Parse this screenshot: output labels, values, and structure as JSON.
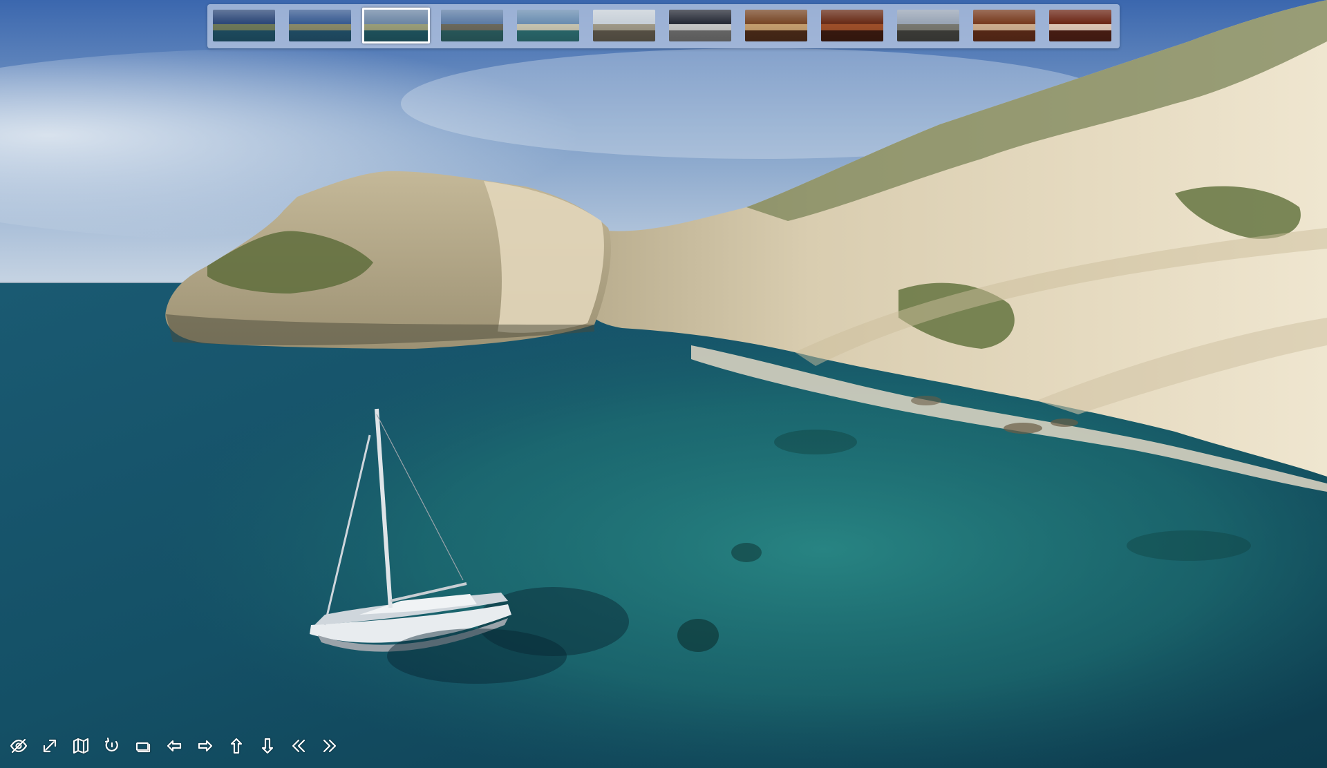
{
  "viewer": {
    "active_thumb_index": 2
  },
  "thumbnails": [
    {
      "name": "thumb-aerial-coast-1",
      "sky": "#2f4a7a",
      "mid": "#6f7a5a",
      "base": "#1e4e63"
    },
    {
      "name": "thumb-aerial-coast-2",
      "sky": "#3b5d93",
      "mid": "#8a8a6a",
      "base": "#214f68"
    },
    {
      "name": "thumb-aerial-coast-3",
      "sky": "#6f88a6",
      "mid": "#9b9f7a",
      "base": "#1f5560"
    },
    {
      "name": "thumb-harbor-aerial",
      "sky": "#5f7ea6",
      "mid": "#6c6a5c",
      "base": "#2a5b5e"
    },
    {
      "name": "thumb-beach-aerial",
      "sky": "#6d8fb2",
      "mid": "#c9c6b2",
      "base": "#2b6a6e"
    },
    {
      "name": "thumb-deck-bow",
      "sky": "#c8d0d8",
      "mid": "#a09a88",
      "base": "#5a5448"
    },
    {
      "name": "thumb-cockpit",
      "sky": "#2a2e3a",
      "mid": "#c9c9c9",
      "base": "#6a6a6a"
    },
    {
      "name": "thumb-cabin-saloon",
      "sky": "#7a4a2a",
      "mid": "#c7a070",
      "base": "#4a2a18"
    },
    {
      "name": "thumb-cabin-galley",
      "sky": "#6a2e1a",
      "mid": "#a0502a",
      "base": "#3a1a10"
    },
    {
      "name": "thumb-deck-stern",
      "sky": "#9aa6b6",
      "mid": "#7a7a72",
      "base": "#3e3e3a"
    },
    {
      "name": "thumb-cabin-forward",
      "sky": "#7a3e22",
      "mid": "#d0b090",
      "base": "#5a2a18"
    },
    {
      "name": "thumb-cabin-aft",
      "sky": "#6e2a1a",
      "mid": "#e0c8b8",
      "base": "#4a1e14"
    }
  ],
  "controls": [
    {
      "name": "hide-controls-button",
      "icon": "eye-slash-icon",
      "label": "Hide"
    },
    {
      "name": "fullscreen-button",
      "icon": "expand-arrows-icon",
      "label": "Fullscreen"
    },
    {
      "name": "map-button",
      "icon": "map-icon",
      "label": "Map"
    },
    {
      "name": "autorotate-button",
      "icon": "rotate-icon",
      "label": "Autorotate"
    },
    {
      "name": "gallery-toggle-button",
      "icon": "thumbnails-icon",
      "label": "Thumbnails"
    },
    {
      "name": "pan-left-button",
      "icon": "arrow-left-icon",
      "label": "Left"
    },
    {
      "name": "pan-right-button",
      "icon": "arrow-right-icon",
      "label": "Right"
    },
    {
      "name": "pan-up-button",
      "icon": "arrow-up-icon",
      "label": "Up"
    },
    {
      "name": "pan-down-button",
      "icon": "arrow-down-icon",
      "label": "Down"
    },
    {
      "name": "previous-pano-button",
      "icon": "double-chevron-left-icon",
      "label": "Previous"
    },
    {
      "name": "next-pano-button",
      "icon": "double-chevron-right-icon",
      "label": "Next"
    }
  ],
  "colors": {
    "sky_top": "#3f6fb8",
    "sky_horizon": "#c7d6e6",
    "sea_deep": "#0e3d52",
    "sea_shallow": "#1f7a78",
    "cliff_light": "#e8dcc0",
    "cliff_shadow": "#b8a888",
    "vegetation": "#5c6e38"
  }
}
